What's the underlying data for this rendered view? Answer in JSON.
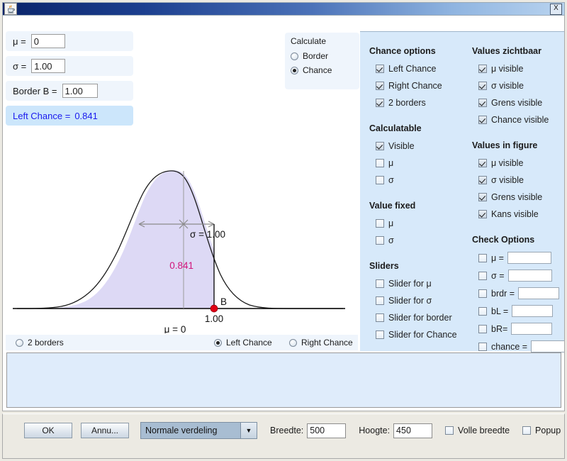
{
  "window": {
    "title": "",
    "icon": "java-coffee-cup-icon",
    "close_label": "X"
  },
  "inputs": {
    "mu_label": "μ =",
    "mu_value": "0",
    "sigma_label": "σ =",
    "sigma_value": "1.00",
    "border_label": "Border B =",
    "border_value": "1.00",
    "result_label": "Left Chance =",
    "result_value": "0.841"
  },
  "calculate": {
    "title": "Calculate",
    "options": [
      {
        "label": "Border",
        "selected": false
      },
      {
        "label": "Chance",
        "selected": true
      }
    ]
  },
  "chance_options": {
    "title": "Chance options",
    "items": [
      {
        "label": "Left Chance",
        "checked": true
      },
      {
        "label": "Right Chance",
        "checked": true
      },
      {
        "label": "2 borders",
        "checked": true
      }
    ]
  },
  "calculatable": {
    "title": "Calculatable",
    "items": [
      {
        "label": "Visible",
        "checked": true
      },
      {
        "label": "μ",
        "checked": false
      },
      {
        "label": "σ",
        "checked": false
      }
    ]
  },
  "value_fixed": {
    "title": "Value fixed",
    "items": [
      {
        "label": "μ",
        "checked": false
      },
      {
        "label": "σ",
        "checked": false
      }
    ]
  },
  "sliders": {
    "title": "Sliders",
    "items": [
      {
        "label": "Slider for μ",
        "checked": false
      },
      {
        "label": "Slider for σ",
        "checked": false
      },
      {
        "label": "Slider for border",
        "checked": false
      },
      {
        "label": "Slider for Chance",
        "checked": false
      }
    ]
  },
  "values_visible": {
    "title": "Values zichtbaar",
    "items": [
      {
        "label": "μ visible",
        "checked": true
      },
      {
        "label": "σ visible",
        "checked": true
      },
      {
        "label": "Grens visible",
        "checked": true
      },
      {
        "label": "Chance visible",
        "checked": true
      }
    ]
  },
  "values_in_figure": {
    "title": "Values in figure",
    "items": [
      {
        "label": "μ visible",
        "checked": true
      },
      {
        "label": "σ visible",
        "checked": true
      },
      {
        "label": "Grens visible",
        "checked": true
      },
      {
        "label": "Kans visible",
        "checked": true
      }
    ]
  },
  "check_options": {
    "title": "Check Options",
    "items": [
      {
        "label": "μ =",
        "checked": false,
        "value": "",
        "field_width": 62
      },
      {
        "label": "σ =",
        "checked": false,
        "value": "",
        "field_width": 62
      },
      {
        "label": "brdr =",
        "checked": false,
        "value": "",
        "field_width": 58
      },
      {
        "label": "bL =",
        "checked": false,
        "value": "",
        "field_width": 58
      },
      {
        "label": "bR=",
        "checked": false,
        "value": "",
        "field_width": 58
      },
      {
        "label": "chance =",
        "checked": false,
        "value": "",
        "field_width": 50
      }
    ]
  },
  "bottom_radios": [
    {
      "label": "2 borders",
      "selected": false
    },
    {
      "label": "Left Chance",
      "selected": true
    },
    {
      "label": "Right Chance",
      "selected": false
    }
  ],
  "toolbar": {
    "ok_label": "OK",
    "cancel_label": "Annu...",
    "combo_value": "Normale verdeling",
    "combo_arrow": "▼",
    "width_label": "Breedte:",
    "width_value": "500",
    "height_label": "Hoogte:",
    "height_value": "450",
    "fullwidth_label": "Volle breedte",
    "fullwidth_checked": false,
    "popup_label": "Popup",
    "popup_checked": false
  },
  "chart_data": {
    "type": "area",
    "title": "",
    "distribution": "normal",
    "mu": 0,
    "sigma": 1.0,
    "border_B": 1.0,
    "left_chance": 0.841,
    "shaded_region": "left of B",
    "annotations": {
      "mu_label": "μ = 0",
      "sigma_label": "σ = 1.00",
      "border_point_label": "B",
      "border_tick_label": "1.00",
      "chance_label": "0.841"
    },
    "colors": {
      "curve": "#000000",
      "fill": "#ddd9f5",
      "point": "#e00014",
      "chance_text": "#d1147a",
      "sigma_arrow": "#808080"
    },
    "xlim": [
      -4.2,
      4.2
    ],
    "ylim": [
      0,
      0.42
    ],
    "grid": false,
    "legend": "none"
  }
}
